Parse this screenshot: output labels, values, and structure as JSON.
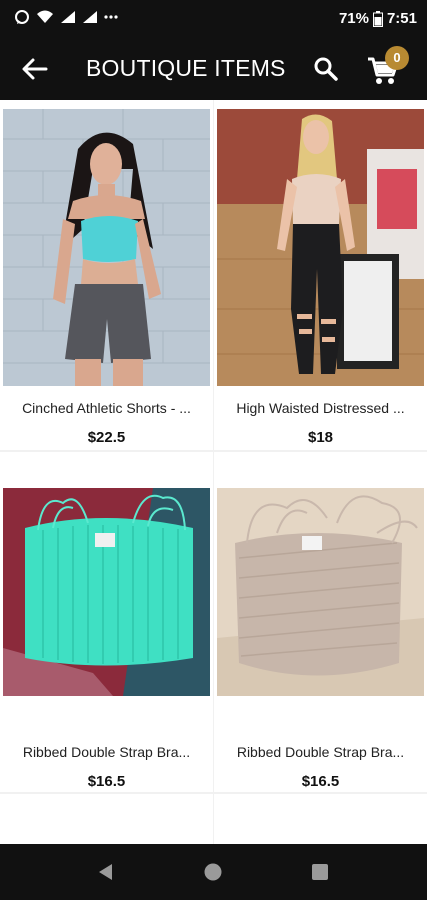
{
  "status_bar": {
    "left_icons": [
      "whatsapp-icon",
      "wifi-icon",
      "signal-icon",
      "signal-icon",
      "more-icon"
    ],
    "battery": "71%",
    "time": "7:51"
  },
  "app_bar": {
    "title": "BOUTIQUE ITEMS",
    "cart_count": "0",
    "badge_color": "#b88a32"
  },
  "products": [
    {
      "name": "Cinched Athletic Shorts - ...",
      "price": "$22.5"
    },
    {
      "name": "High Waisted Distressed ...",
      "price": "$18"
    },
    {
      "name": "Ribbed Double Strap Bra...",
      "price": "$16.5"
    },
    {
      "name": "Ribbed Double Strap Bra...",
      "price": "$16.5"
    }
  ],
  "nav_bar": {
    "icons": [
      "back-triangle-icon",
      "home-circle-icon",
      "recents-square-icon"
    ]
  }
}
